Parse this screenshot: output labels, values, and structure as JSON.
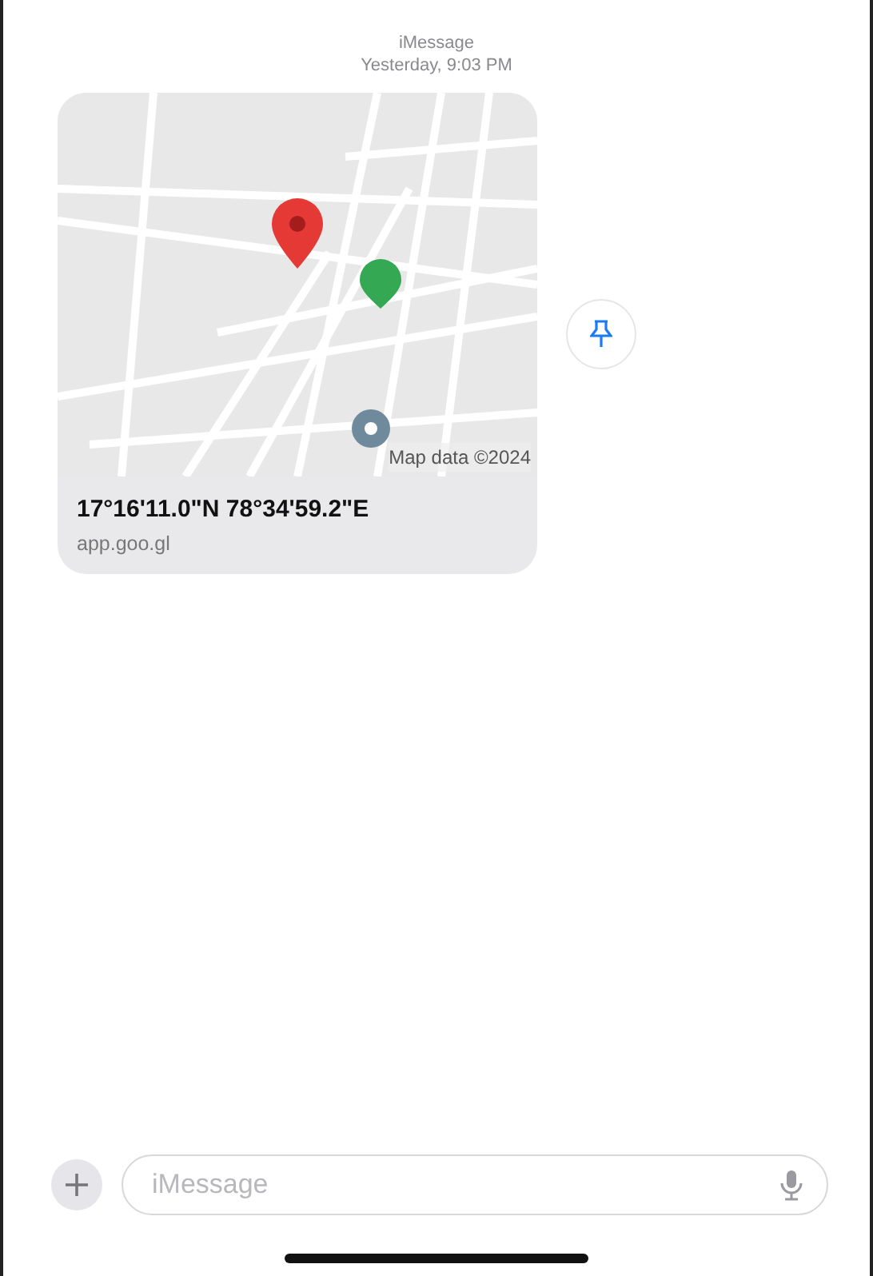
{
  "header": {
    "service": "iMessage",
    "timestamp": "Yesterday, 9:03 PM"
  },
  "location_message": {
    "map": {
      "kind": "picture",
      "attribution": "Map data ©2024"
    },
    "title": "17°16'11.0\"N 78°34'59.2\"E",
    "domain": "app.goo.gl"
  },
  "compose": {
    "placeholder": "iMessage"
  }
}
